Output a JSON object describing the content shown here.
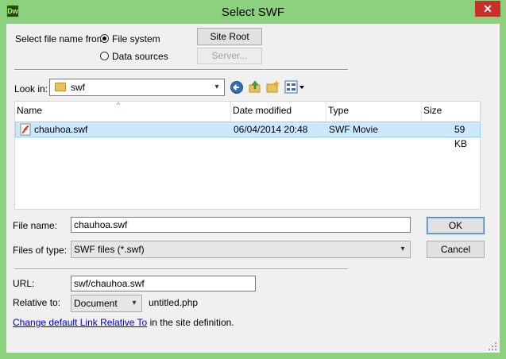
{
  "window": {
    "title": "Select SWF",
    "app_icon": "Dw",
    "close_glyph": "✕"
  },
  "select_from": {
    "label": "Select file name from:",
    "options": [
      "File system",
      "Data sources"
    ],
    "selected": "File system",
    "site_root_label": "Site Root",
    "server_label": "Server..."
  },
  "lookin": {
    "label": "Look in:",
    "value": "swf",
    "icons": [
      "back-icon",
      "up-folder-icon",
      "new-folder-icon",
      "view-menu-icon"
    ]
  },
  "files": {
    "columns": [
      "Name",
      "Date modified",
      "Type",
      "Size"
    ],
    "rows": [
      {
        "name": "chauhoa.swf",
        "date": "06/04/2014 20:48",
        "type": "SWF Movie",
        "size": "59 KB"
      }
    ]
  },
  "form": {
    "file_name_label": "File name:",
    "file_name_value": "chauhoa.swf",
    "files_of_type_label": "Files of type:",
    "files_of_type_value": "SWF files (*.swf)",
    "ok_label": "OK",
    "cancel_label": "Cancel",
    "url_label": "URL:",
    "url_value": "swf/chauhoa.swf",
    "relative_label": "Relative to:",
    "relative_value": "Document",
    "relative_file": "untitled.php",
    "link_text": "Change default Link Relative To",
    "link_suffix": " in the site definition."
  },
  "colors": {
    "frame": "#8cd17d",
    "selection": "#cce8ff",
    "close": "#c7312a"
  }
}
